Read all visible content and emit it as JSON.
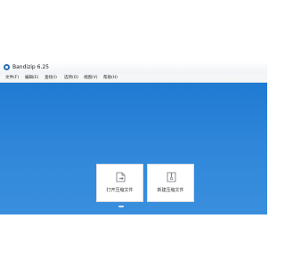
{
  "window": {
    "title": "Bandizip 6.25"
  },
  "menu": {
    "items": [
      "文件(F)",
      "编辑(E)",
      "查找(I)",
      "选项(O)",
      "视图(V)",
      "帮助(H)"
    ]
  },
  "actions": {
    "open_label": "打开压缩文件",
    "new_label": "新建压缩文件"
  },
  "colors": {
    "desktop": "#2f86d9",
    "card": "#ffffff"
  },
  "icons": {
    "app": "bandizip-icon",
    "open": "open-archive-icon",
    "new": "new-archive-icon"
  }
}
